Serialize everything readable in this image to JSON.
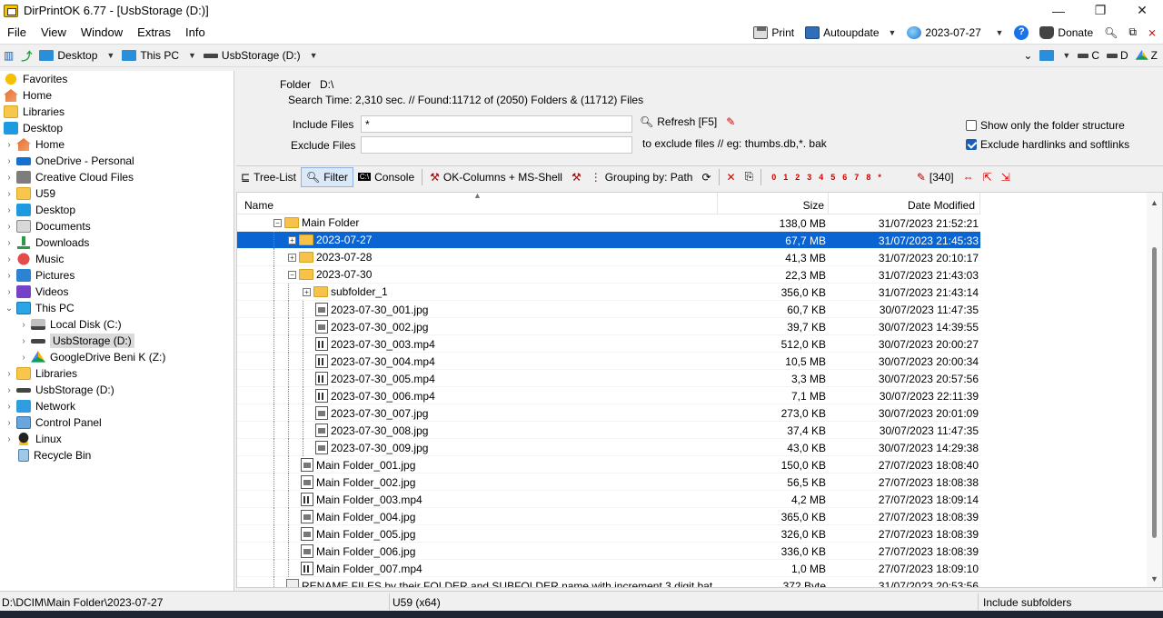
{
  "window": {
    "title": "DirPrintOK 6.77 - [UsbStorage (D:)]"
  },
  "menu": {
    "items": [
      "File",
      "View",
      "Window",
      "Extras",
      "Info"
    ]
  },
  "menu_right": {
    "print": "Print",
    "autoupdate": "Autoupdate",
    "date": "2023-07-27",
    "donate": "Donate"
  },
  "location": {
    "desktop": "Desktop",
    "thispc": "This PC",
    "drive": "UsbStorage (D:)",
    "right_drives": [
      "C",
      "D",
      "Z"
    ]
  },
  "tree": [
    {
      "label": "Favorites",
      "icon": "star-icon",
      "level": 0,
      "exp": ""
    },
    {
      "label": "Home",
      "icon": "home-icon",
      "level": 0,
      "exp": ""
    },
    {
      "label": "Libraries",
      "icon": "folder-icon",
      "level": 0,
      "exp": ""
    },
    {
      "label": "Desktop",
      "icon": "desktop-icon",
      "level": 0,
      "exp": ""
    },
    {
      "label": "Home",
      "icon": "home-icon",
      "level": 1,
      "exp": "›"
    },
    {
      "label": "OneDrive - Personal",
      "icon": "cloud-icon",
      "level": 1,
      "exp": "›"
    },
    {
      "label": "Creative Cloud Files",
      "icon": "creative-cloud-icon",
      "level": 1,
      "exp": "›"
    },
    {
      "label": "U59",
      "icon": "folder-icon",
      "level": 1,
      "exp": "›"
    },
    {
      "label": "Desktop",
      "icon": "desktop-icon",
      "level": 1,
      "exp": "›"
    },
    {
      "label": "Documents",
      "icon": "documents-icon",
      "level": 1,
      "exp": "›"
    },
    {
      "label": "Downloads",
      "icon": "downloads-icon",
      "level": 1,
      "exp": "›"
    },
    {
      "label": "Music",
      "icon": "music-icon",
      "level": 1,
      "exp": "›"
    },
    {
      "label": "Pictures",
      "icon": "pictures-icon",
      "level": 1,
      "exp": "›"
    },
    {
      "label": "Videos",
      "icon": "videos-icon",
      "level": 1,
      "exp": "›"
    },
    {
      "label": "This PC",
      "icon": "pc-icon",
      "level": 1,
      "exp": "⌄"
    },
    {
      "label": "Local Disk (C:)",
      "icon": "local-disk-icon",
      "level": 2,
      "exp": "›"
    },
    {
      "label": "UsbStorage (D:)",
      "icon": "usb-drive-icon",
      "level": 2,
      "exp": "›",
      "selected": true
    },
    {
      "label": "GoogleDrive Beni K (Z:)",
      "icon": "google-drive-icon",
      "level": 2,
      "exp": "›"
    },
    {
      "label": "Libraries",
      "icon": "folder-icon",
      "level": 1,
      "exp": "›"
    },
    {
      "label": "UsbStorage (D:)",
      "icon": "usb-drive-icon",
      "level": 1,
      "exp": "›"
    },
    {
      "label": "Network",
      "icon": "network-icon",
      "level": 1,
      "exp": "›"
    },
    {
      "label": "Control Panel",
      "icon": "control-panel-icon",
      "level": 1,
      "exp": "›"
    },
    {
      "label": "Linux",
      "icon": "linux-icon",
      "level": 1,
      "exp": "›"
    },
    {
      "label": "Recycle Bin",
      "icon": "recycle-bin-icon",
      "level": 1,
      "exp": ""
    }
  ],
  "filter": {
    "folder_label": "Folder",
    "folder_value": "D:\\",
    "search_info": "Search Time: 2,310 sec. //  Found:11712 of (2050) Folders & (11712) Files",
    "include_label": "Include Files",
    "include_value": "*",
    "exclude_label": "Exclude Files",
    "exclude_value": "",
    "refresh": "Refresh [F5]",
    "exclude_hint": "to exclude files // eg: thumbs.db,*. bak",
    "only_folder_structure": "Show only the folder structure",
    "only_folder_checked": false,
    "exclude_links": "Exclude hardlinks and softlinks",
    "exclude_links_checked": true
  },
  "toolbar2": {
    "tree_list": "Tree-List",
    "filter": "Filter",
    "console": "Console",
    "ok_columns": "OK-Columns + MS-Shell",
    "grouping": "Grouping by: Path",
    "count": "[340]",
    "levels": [
      "0",
      "1",
      "2",
      "3",
      "4",
      "5",
      "6",
      "7",
      "8",
      "*"
    ]
  },
  "columns": {
    "name": "Name",
    "size": "Size",
    "date": "Date Modified"
  },
  "rows": [
    {
      "name": "Main Folder",
      "size": "138,0 MB",
      "date": "31/07/2023 21:52:21",
      "type": "folder",
      "indent": 40,
      "exp": "−",
      "guides": []
    },
    {
      "name": "2023-07-27",
      "size": "67,7 MB",
      "date": "31/07/2023 21:45:33",
      "type": "folder",
      "indent": 56,
      "exp": "+",
      "selected": true,
      "guides": [
        40
      ]
    },
    {
      "name": "2023-07-28",
      "size": "41,3 MB",
      "date": "31/07/2023 20:10:17",
      "type": "folder",
      "indent": 56,
      "exp": "+",
      "guides": [
        40
      ]
    },
    {
      "name": "2023-07-30",
      "size": "22,3 MB",
      "date": "31/07/2023 21:43:03",
      "type": "folder",
      "indent": 56,
      "exp": "−",
      "guides": [
        40
      ]
    },
    {
      "name": "subfolder_1",
      "size": "356,0 KB",
      "date": "31/07/2023 21:43:14",
      "type": "folder",
      "indent": 72,
      "exp": "+",
      "guides": [
        40,
        56
      ]
    },
    {
      "name": "2023-07-30_001.jpg",
      "size": "60,7 KB",
      "date": "30/07/2023 11:47:35",
      "type": "jpg",
      "indent": 86,
      "exp": "",
      "guides": [
        40,
        56,
        72
      ]
    },
    {
      "name": "2023-07-30_002.jpg",
      "size": "39,7 KB",
      "date": "30/07/2023 14:39:55",
      "type": "jpg",
      "indent": 86,
      "exp": "",
      "guides": [
        40,
        56,
        72
      ]
    },
    {
      "name": "2023-07-30_003.mp4",
      "size": "512,0 KB",
      "date": "30/07/2023 20:00:27",
      "type": "mp4",
      "indent": 86,
      "exp": "",
      "guides": [
        40,
        56,
        72
      ]
    },
    {
      "name": "2023-07-30_004.mp4",
      "size": "10,5 MB",
      "date": "30/07/2023 20:00:34",
      "type": "mp4",
      "indent": 86,
      "exp": "",
      "guides": [
        40,
        56,
        72
      ]
    },
    {
      "name": "2023-07-30_005.mp4",
      "size": "3,3 MB",
      "date": "30/07/2023 20:57:56",
      "type": "mp4",
      "indent": 86,
      "exp": "",
      "guides": [
        40,
        56,
        72
      ]
    },
    {
      "name": "2023-07-30_006.mp4",
      "size": "7,1 MB",
      "date": "30/07/2023 22:11:39",
      "type": "mp4",
      "indent": 86,
      "exp": "",
      "guides": [
        40,
        56,
        72
      ]
    },
    {
      "name": "2023-07-30_007.jpg",
      "size": "273,0 KB",
      "date": "30/07/2023 20:01:09",
      "type": "jpg",
      "indent": 86,
      "exp": "",
      "guides": [
        40,
        56,
        72
      ]
    },
    {
      "name": "2023-07-30_008.jpg",
      "size": "37,4 KB",
      "date": "30/07/2023 11:47:35",
      "type": "jpg",
      "indent": 86,
      "exp": "",
      "guides": [
        40,
        56,
        72
      ]
    },
    {
      "name": "2023-07-30_009.jpg",
      "size": "43,0 KB",
      "date": "30/07/2023 14:29:38",
      "type": "jpg",
      "indent": 86,
      "exp": "",
      "guides": [
        40,
        56,
        72
      ]
    },
    {
      "name": "Main Folder_001.jpg",
      "size": "150,0 KB",
      "date": "27/07/2023 18:08:40",
      "type": "jpg",
      "indent": 70,
      "exp": "",
      "guides": [
        40,
        56
      ]
    },
    {
      "name": "Main Folder_002.jpg",
      "size": "56,5 KB",
      "date": "27/07/2023 18:08:38",
      "type": "jpg",
      "indent": 70,
      "exp": "",
      "guides": [
        40,
        56
      ]
    },
    {
      "name": "Main Folder_003.mp4",
      "size": "4,2 MB",
      "date": "27/07/2023 18:09:14",
      "type": "mp4",
      "indent": 70,
      "exp": "",
      "guides": [
        40,
        56
      ]
    },
    {
      "name": "Main Folder_004.jpg",
      "size": "365,0 KB",
      "date": "27/07/2023 18:08:39",
      "type": "jpg",
      "indent": 70,
      "exp": "",
      "guides": [
        40,
        56
      ]
    },
    {
      "name": "Main Folder_005.jpg",
      "size": "326,0 KB",
      "date": "27/07/2023 18:08:39",
      "type": "jpg",
      "indent": 70,
      "exp": "",
      "guides": [
        40,
        56
      ]
    },
    {
      "name": "Main Folder_006.jpg",
      "size": "336,0 KB",
      "date": "27/07/2023 18:08:39",
      "type": "jpg",
      "indent": 70,
      "exp": "",
      "guides": [
        40,
        56
      ]
    },
    {
      "name": "Main Folder_007.mp4",
      "size": "1,0 MB",
      "date": "27/07/2023 18:09:10",
      "type": "mp4",
      "indent": 70,
      "exp": "",
      "guides": [
        40,
        56
      ]
    },
    {
      "name": "RENAME FILES by their FOLDER and SUBFOLDER name with increment 3 digit.bat",
      "size": "372 Byte",
      "date": "31/07/2023 20:53:56",
      "type": "bat",
      "indent": 54,
      "exp": "",
      "guides": [
        40
      ]
    }
  ],
  "status": {
    "path": "D:\\DCIM\\Main Folder\\2023-07-27",
    "user": "U59 (x64)",
    "subfolders": "Include subfolders"
  }
}
